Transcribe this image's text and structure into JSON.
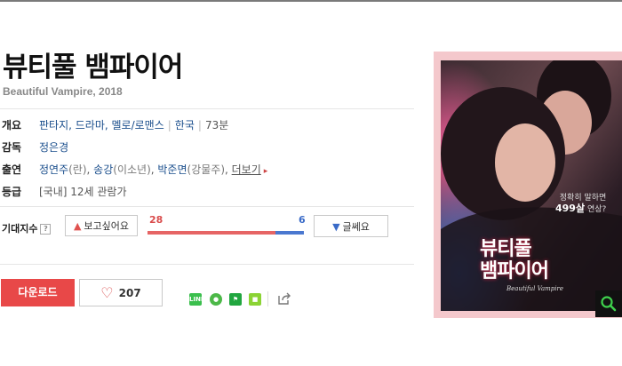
{
  "movie": {
    "title": "뷰티풀 뱀파이어",
    "subtitle": "Beautiful Vampire, 2018"
  },
  "info": {
    "overview": {
      "label": "개요",
      "genres": "판타지, 드라마, 멜로/로맨스",
      "country": "한국",
      "runtime": "73분"
    },
    "director": {
      "label": "감독",
      "name": "정은경"
    },
    "cast": {
      "label": "출연",
      "actor1": "정연주",
      "role1": "(란)",
      "actor2": "송강",
      "role2": "(이소년)",
      "actor3": "박준면",
      "role3": "(강물주)",
      "more": "더보기"
    },
    "rating": {
      "label": "등급",
      "value": "[국내] 12세 관람가"
    }
  },
  "expect": {
    "label": "기대지수",
    "help": "?",
    "want_label": "보고싶어요",
    "want_count": "28",
    "dislike_label": "글쎄요",
    "dislike_count": "6",
    "want_ratio": 0.82
  },
  "actions": {
    "download_label": "다운로드",
    "like_count": "207"
  },
  "share_icons": [
    "line-icon",
    "kakaostory-icon",
    "band-icon",
    "memo-icon",
    "share-icon"
  ],
  "poster": {
    "tagline_line1": "정확히 말하면",
    "tagline_line2": "499살",
    "tagline_line3": "연상?",
    "title_line1": "뷰티풀",
    "title_line2": "뱀파이어",
    "script_title": "Beautiful Vampire"
  },
  "colors": {
    "accent_red": "#e84848",
    "link_blue": "#1a4e8c",
    "gauge_red": "#e66565",
    "gauge_blue": "#4a78d0",
    "poster_frame": "#f4c8cc"
  }
}
